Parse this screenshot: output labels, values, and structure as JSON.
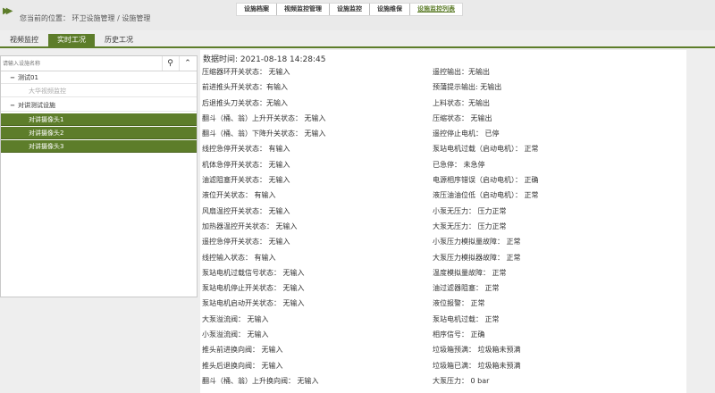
{
  "header": {
    "home_icon": "double-arrow-icon",
    "breadcrumb": "您当前的位置：  环卫设施管理 / 设施管理",
    "nav": [
      {
        "label": "设施档案",
        "active": false
      },
      {
        "label": "视频监控管理",
        "active": false
      },
      {
        "label": "设施监控",
        "active": false
      },
      {
        "label": "设施维保",
        "active": false
      },
      {
        "label": "设施监控列表",
        "active": true
      }
    ]
  },
  "tabs": [
    {
      "label": "视频监控"
    },
    {
      "label": "实时工况"
    },
    {
      "label": "历史工况"
    }
  ],
  "sidebar": {
    "search_placeholder": "请输入设施名称",
    "search_icon": "search-icon",
    "collapse_icon": "chevron-up-icon",
    "tree": [
      {
        "label": "测试01",
        "toggle": "−",
        "level": 0
      },
      {
        "label": "大华视频监控",
        "toggle": "",
        "level": 1
      },
      {
        "label": "对讲测试设施",
        "toggle": "−",
        "level": 0
      },
      {
        "label": "对讲摄像头1",
        "toggle": "",
        "level": 1
      },
      {
        "label": "对讲摄像头2",
        "toggle": "",
        "level": 1
      },
      {
        "label": "对讲摄像头3",
        "toggle": "",
        "level": 1
      }
    ]
  },
  "data": {
    "timestamp": "数据时间: 2021-08-18 14:28:45",
    "left": [
      "压缩器环开关状态：  无输入",
      "前进推头开关状态：有输入",
      "后退推头刀关状态：无输入",
      "翻斗（桶、翁）上升开关状态：  无输入",
      "翻斗（桶、翁）下降升关状态：  无输入",
      "线控急停开关状态：  有输入",
      "机体急停开关状态：  无输入",
      "油滤阻塞开关状态：  无输入",
      "液位开关状态：  有输入",
      "风扇温控开关状态：  无输入",
      "加热器温控开关状态：  无输入",
      "遥控急停开关状态：  无输入",
      "线控输入状态：  有输入",
      "泵站电机过载信号状态：  无输入",
      "泵站电机停止开关状态：  无输入",
      "泵站电机启动开关状态：  无输入",
      "大泵溢流阀：  无输入",
      "小泵溢流阀：  无输入",
      "推头前进换向阀：  无输入",
      "推头后退换向阀：  无输入",
      "翻斗（桶、翁）上升换向阀：  无输入"
    ],
    "right": [
      "遥控输出：无输出",
      "预蒲提示输出: 无输出",
      "上料状态：无输出",
      "压缩状态：  无输出",
      "遥控停止电机：  已停",
      "泵站电机过载（启动电机）：  正常",
      "已急停：  未急停",
      "电源相序错误（启动电机）：  正确",
      "液压油油位低（启动电机）：  正常",
      "小泵无压力：  压力正常",
      "大泵无压力：  压力正常",
      "小泵压力模拟量故障：  正常",
      "大泵压力模拟器故障：  正常",
      "温度模拟量故障：  正常",
      "油过滤器阻塞：  正常",
      "液位报警：  正常",
      "泵站电机过载：  正常",
      "相序信号：  正确",
      "垃圾箱预满：  垃圾箱未预满",
      "垃圾箱已满：  垃圾箱未预满",
      "大泵压力：  0 bar"
    ]
  }
}
